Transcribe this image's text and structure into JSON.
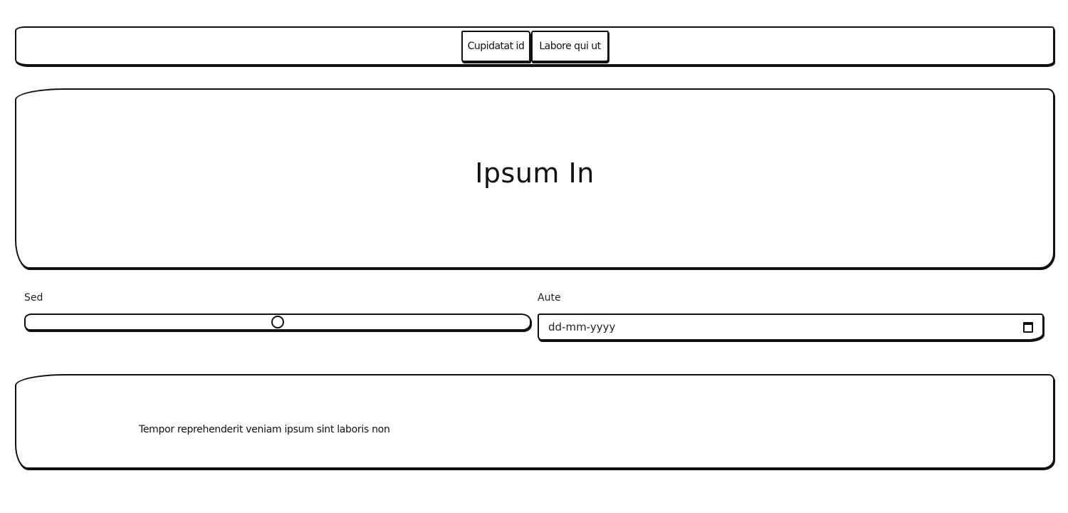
{
  "nav": {
    "buttons": [
      {
        "label": "Cupidatat id"
      },
      {
        "label": "Labore qui ut"
      }
    ]
  },
  "hero": {
    "title": "Ipsum In"
  },
  "form": {
    "slider": {
      "label": "Sed",
      "value_fraction": 0.5
    },
    "date": {
      "label": "Aute",
      "placeholder": "dd-mm-yyyy",
      "icon": "calendar-icon"
    }
  },
  "footer": {
    "text": "Tempor reprehenderit veniam ipsum sint laboris non"
  }
}
